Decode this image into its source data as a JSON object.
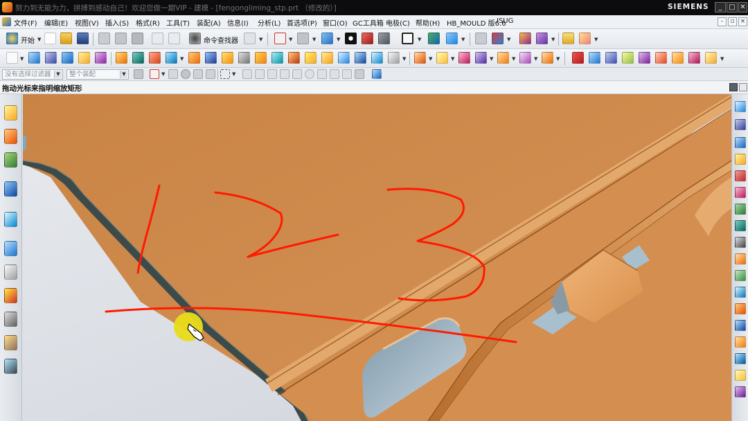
{
  "window": {
    "title": "努力到无能为力，拼搏到感动自己！欢迎您做一期VIP - 建模 - [fengongliming_stp.prt （修改的）]",
    "brand": "SIEMENS",
    "controls": {
      "minimize": "_",
      "maximize": "□",
      "close": "✕"
    }
  },
  "menubar": {
    "items": [
      "文件(F)",
      "编辑(E)",
      "视图(V)",
      "插入(S)",
      "格式(R)",
      "工具(T)",
      "装配(A)",
      "信息(I)",
      "分析(L)",
      "首选项(P)",
      "窗口(O)",
      "GC工具箱",
      "电极(C)",
      "帮助(H)",
      "HB_MOULD 版6.6",
      "ISUG"
    ],
    "mdi_controls": {
      "minimize": "-",
      "restore": "▫",
      "close": "×"
    }
  },
  "toolbar": {
    "start_label": "开始",
    "command_finder_label": "命令查找器"
  },
  "selection_bar": {
    "filter_placeholder": "没有选择过滤器",
    "scope_value": "整个装配"
  },
  "cue_line": {
    "text": "拖动光标来指明缩放矩形"
  },
  "colors": {
    "part_face": "#cf8a4a",
    "part_edge": "#3f4f4c",
    "pocket": "#8aa6b8",
    "annotation": "#ff1a00",
    "cursor_highlight": "#e8dc1a",
    "title_bar": "#0c0c0e"
  },
  "icons": {
    "left_resource_bar": [
      "assembly-navigator-icon",
      "constraint-navigator-icon",
      "part-navigator-icon",
      "reuse-library-icon",
      "hd3d-tools-icon",
      "history-icon",
      "system-materials-icon",
      "process-studio-icon",
      "roles-icon",
      "system-scene-icon"
    ],
    "right_bar": [
      "extrude-icon",
      "revolve-icon",
      "block-icon",
      "cylinder-icon",
      "cone-icon",
      "sphere-icon",
      "hole-icon",
      "boss-icon",
      "pocket-icon",
      "pad-icon",
      "emboss-icon",
      "offset-face-icon",
      "shell-icon",
      "edge-blend-icon",
      "chamfer-icon",
      "draft-icon",
      "trim-body-icon",
      "split-body-icon"
    ]
  },
  "annotations": [
    "1",
    "2",
    "3"
  ]
}
